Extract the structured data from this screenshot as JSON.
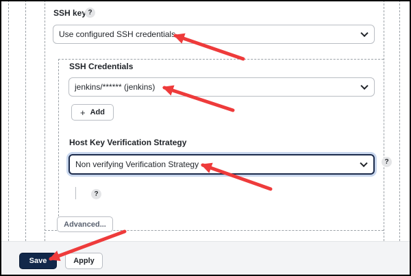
{
  "ssh_key": {
    "label": "SSH key",
    "help": "?",
    "selected": "Use configured SSH credentials"
  },
  "ssh_credentials": {
    "label": "SSH Credentials",
    "selected": "jenkins/****** (jenkins)",
    "add_label": "Add",
    "add_icon": "+"
  },
  "host_key": {
    "label": "Host Key Verification Strategy",
    "selected": "Non verifying Verification Strategy",
    "help": "?"
  },
  "extra_help": "?",
  "advanced_label": "Advanced...",
  "footer": {
    "save_label": "Save",
    "apply_label": "Apply"
  },
  "colors": {
    "primary": "#12284a",
    "arrow": "#ee3b3b"
  }
}
